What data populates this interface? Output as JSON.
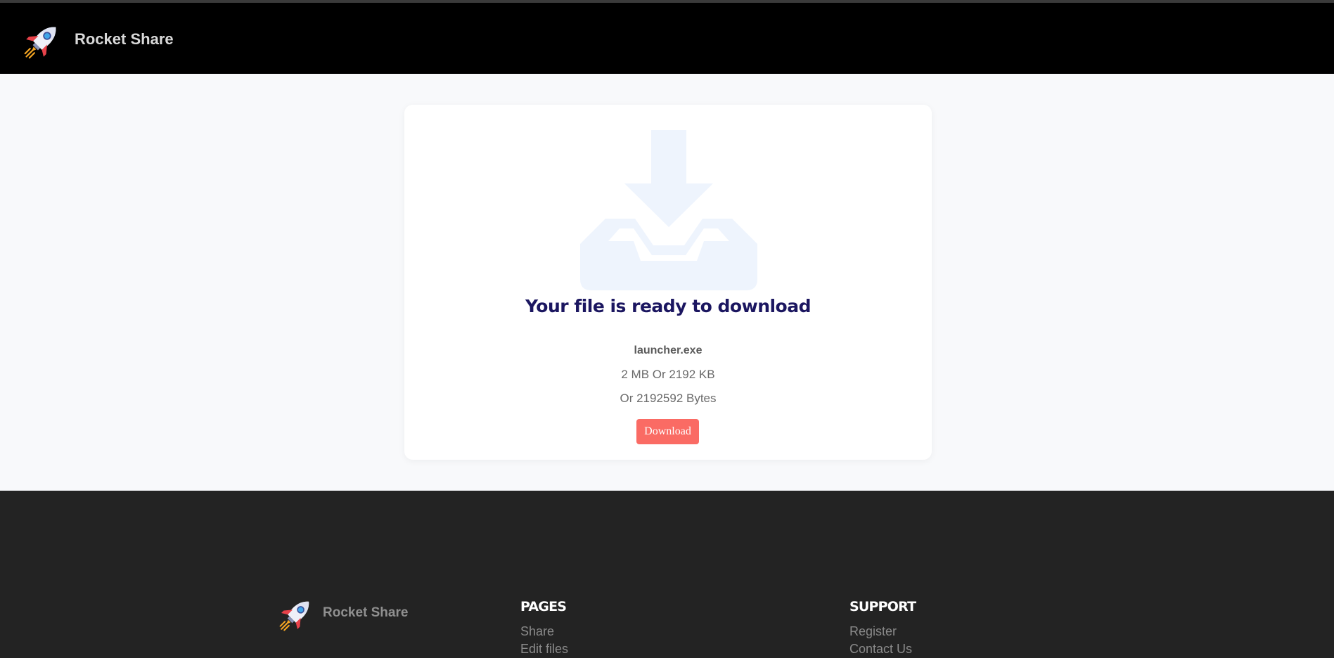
{
  "app": {
    "name": "Rocket Share"
  },
  "main": {
    "title": "Your file is ready to download",
    "file_name": "launcher.exe",
    "file_size": "2 MB Or 2192 KB",
    "file_bytes": "Or 2192592 Bytes",
    "download_label": "Download",
    "icon": "download-tray-icon"
  },
  "footer": {
    "brand": "Rocket Share",
    "pages": {
      "heading": "PAGES",
      "links": [
        "Share",
        "Edit files"
      ]
    },
    "support": {
      "heading": "SUPPORT",
      "links": [
        "Register",
        "Contact Us"
      ]
    }
  },
  "colors": {
    "header_bg": "#000000",
    "footer_bg": "#232323",
    "accent_button": "#fa6b64",
    "title_text": "#1b1660",
    "icon_tint": "#eef4fd"
  }
}
